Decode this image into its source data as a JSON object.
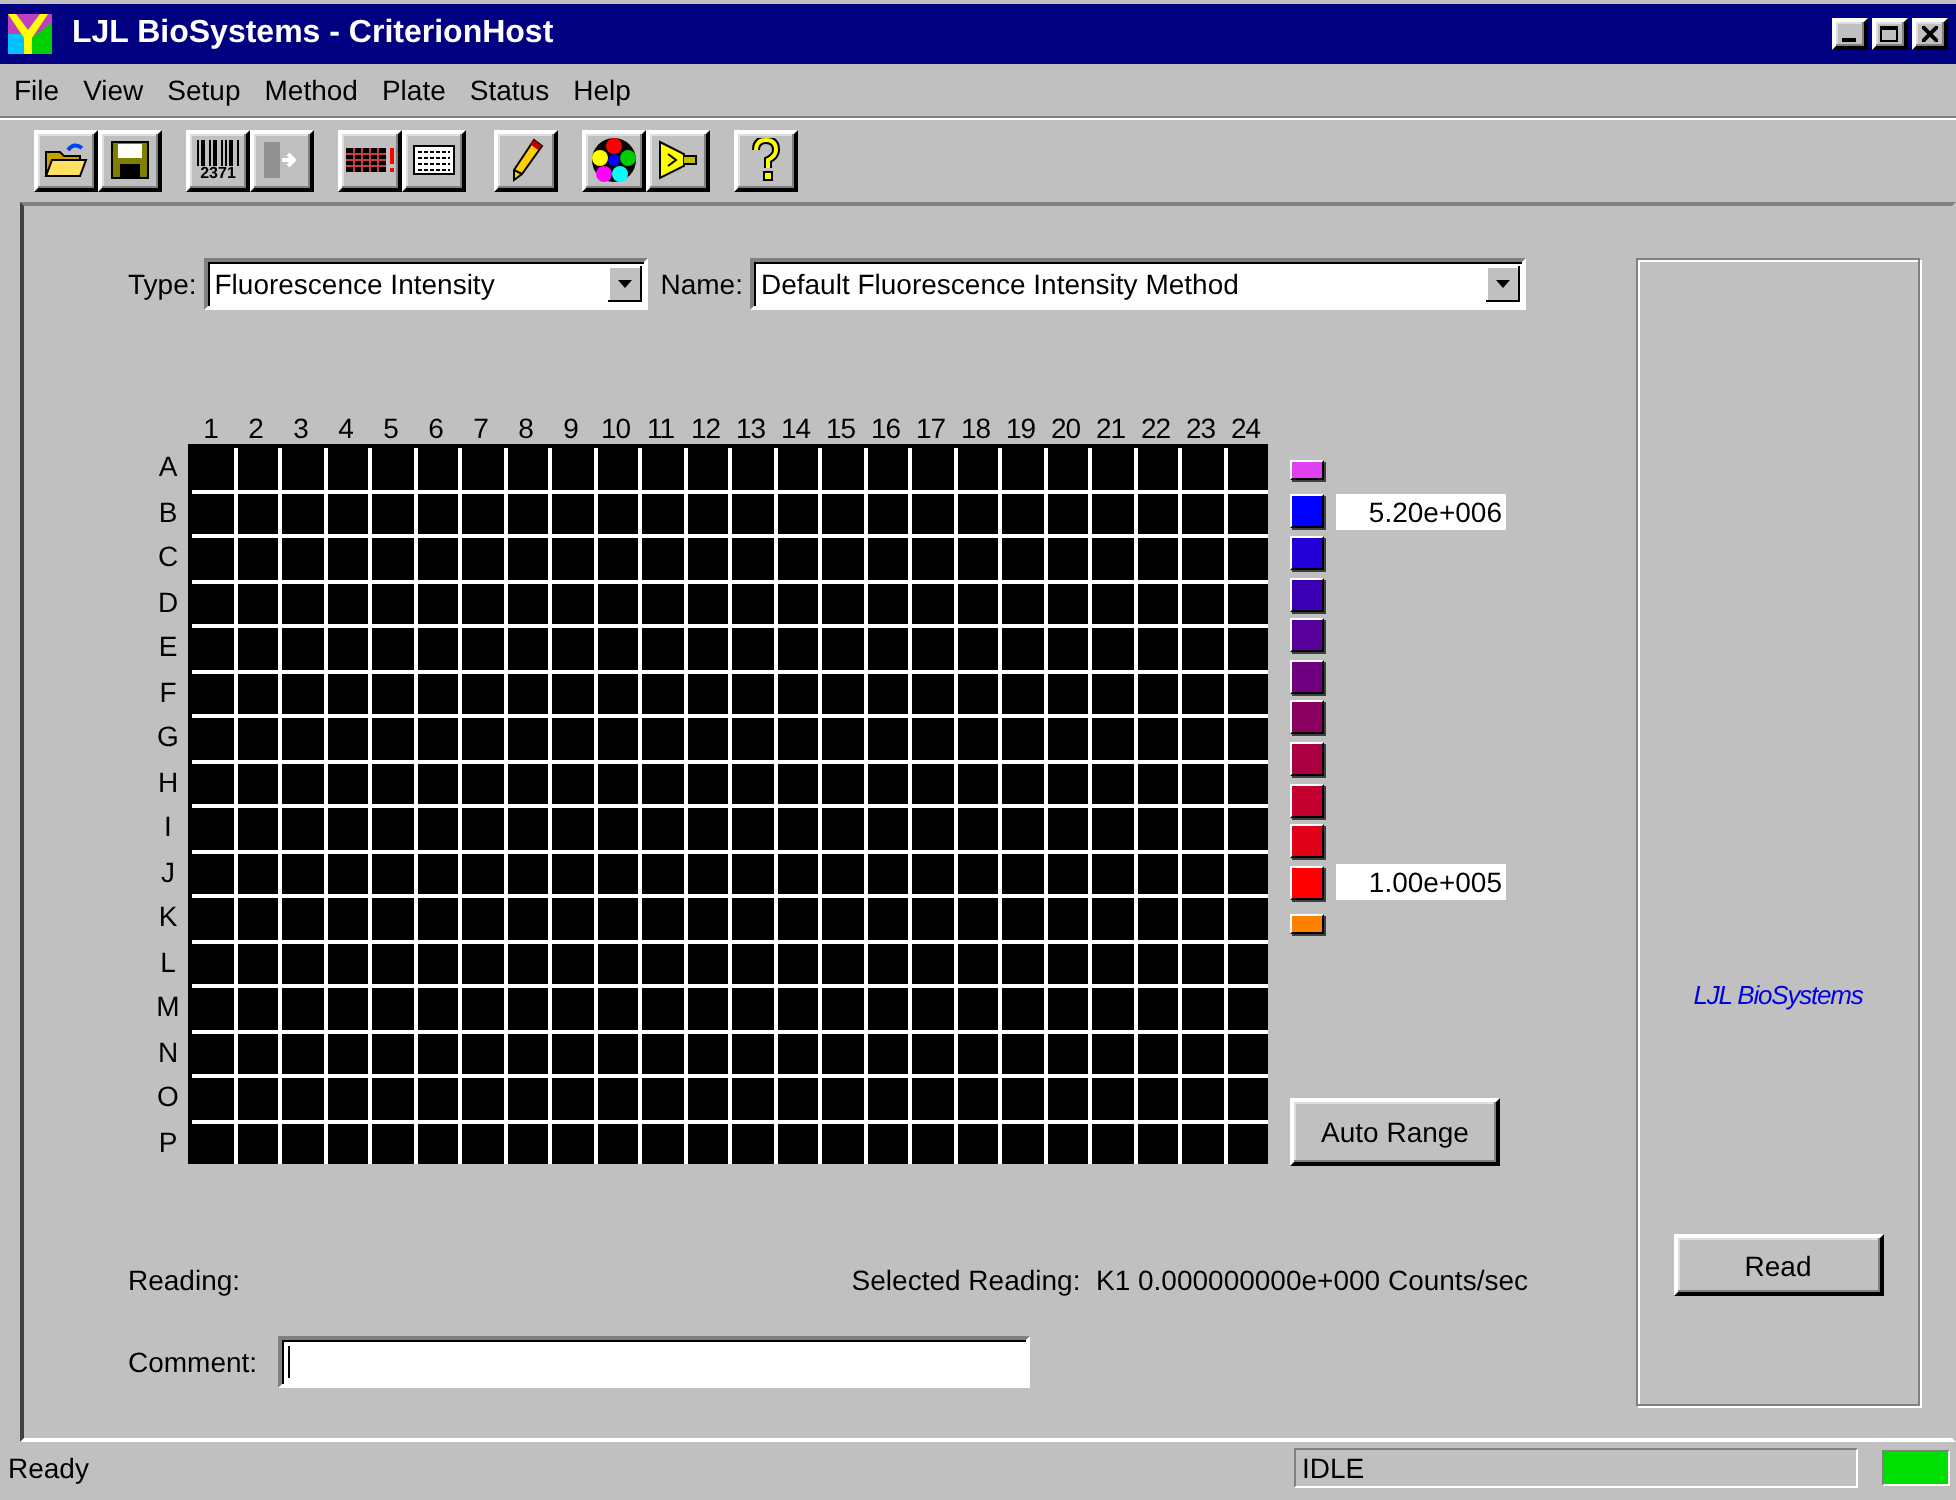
{
  "window": {
    "title": "LJL BioSystems - CriterionHost"
  },
  "menu": [
    "File",
    "View",
    "Setup",
    "Method",
    "Plate",
    "Status",
    "Help"
  ],
  "toolbar": [
    {
      "kind": "open"
    },
    {
      "kind": "save"
    },
    {
      "kind": "barcode",
      "label": "2371"
    },
    {
      "kind": "export",
      "disabled": true
    },
    {
      "kind": "plate-color"
    },
    {
      "kind": "plate"
    },
    {
      "kind": "pencil"
    },
    {
      "kind": "wheel"
    },
    {
      "kind": "lamp"
    },
    {
      "kind": "help"
    }
  ],
  "method": {
    "type_label": "Type:",
    "type_value": "Fluorescence Intensity",
    "name_label": "Name:",
    "name_value": "Default Fluorescence Intensity Method"
  },
  "plate": {
    "columns": [
      "1",
      "2",
      "3",
      "4",
      "5",
      "6",
      "7",
      "8",
      "9",
      "10",
      "11",
      "12",
      "13",
      "14",
      "15",
      "16",
      "17",
      "18",
      "19",
      "20",
      "21",
      "22",
      "23",
      "24"
    ],
    "rows": [
      "A",
      "B",
      "C",
      "D",
      "E",
      "F",
      "G",
      "H",
      "I",
      "J",
      "K",
      "L",
      "M",
      "N",
      "O",
      "P"
    ]
  },
  "legend": [
    {
      "kind": "over",
      "color": "#e040f0"
    },
    {
      "kind": "step",
      "color": "#0000ff",
      "value": "5.20e+006"
    },
    {
      "kind": "step",
      "color": "#2400d8"
    },
    {
      "kind": "step",
      "color": "#3c00b4"
    },
    {
      "kind": "step",
      "color": "#58009c"
    },
    {
      "kind": "step",
      "color": "#700080"
    },
    {
      "kind": "step",
      "color": "#8c0060"
    },
    {
      "kind": "step",
      "color": "#a80040"
    },
    {
      "kind": "step",
      "color": "#c40030"
    },
    {
      "kind": "step",
      "color": "#e00018"
    },
    {
      "kind": "step",
      "color": "#ff0000",
      "value": "1.00e+005"
    },
    {
      "kind": "under",
      "color": "#ff8000"
    }
  ],
  "auto_range_button": "Auto Range",
  "reading_label": "Reading:",
  "selected_reading": "Selected Reading:  K1 0.000000000e+000 Counts/sec",
  "comment": {
    "label": "Comment:"
  },
  "side_panel": {
    "logo_text": "LJL BioSystems",
    "read_button": "Read"
  },
  "status_bar": {
    "panels": [
      {
        "kind": "message",
        "text": "Ready"
      },
      {
        "kind": "field",
        "text": "IDLE"
      },
      {
        "kind": "indicator",
        "color": "#00e000"
      }
    ]
  }
}
